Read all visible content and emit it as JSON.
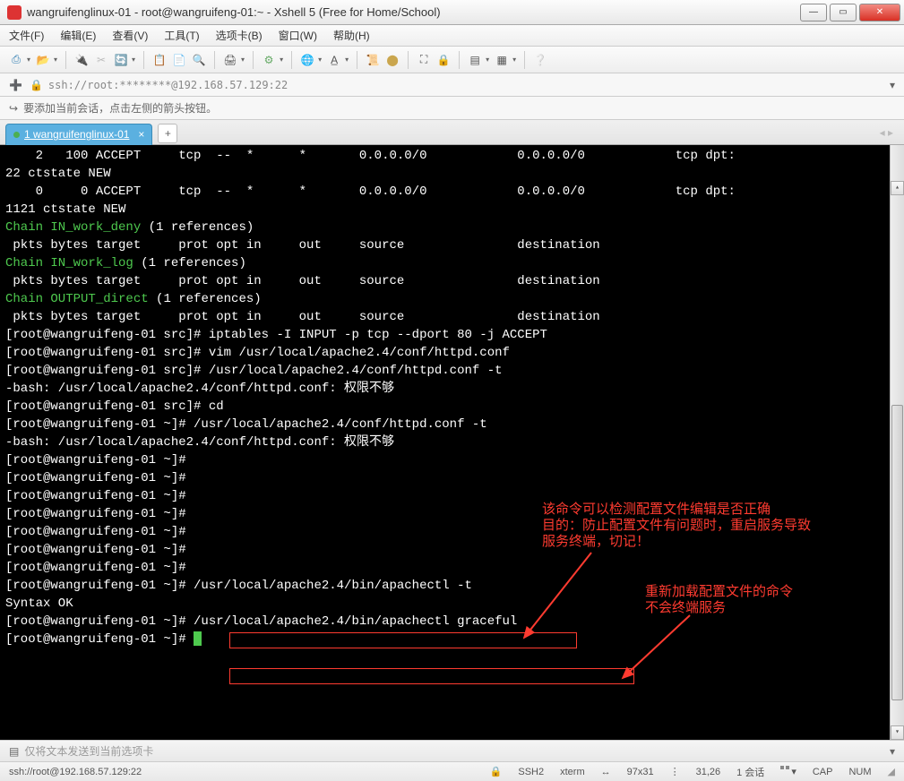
{
  "window": {
    "title": "wangruifenglinux-01 - root@wangruifeng-01:~ - Xshell 5 (Free for Home/School)"
  },
  "menu": {
    "file": "文件(F)",
    "edit": "编辑(E)",
    "view": "查看(V)",
    "tools": "工具(T)",
    "tabs": "选项卡(B)",
    "window": "窗口(W)",
    "help": "帮助(H)"
  },
  "address": "ssh://root:********@192.168.57.129:22",
  "infobar_text": "要添加当前会话，点击左侧的箭头按钮。",
  "tab": {
    "name": "1 wangruifenglinux-01"
  },
  "terminal_lines": [
    "    2   100 ACCEPT     tcp  --  *      *       0.0.0.0/0            0.0.0.0/0            tcp dpt:",
    "22 ctstate NEW",
    "    0     0 ACCEPT     tcp  --  *      *       0.0.0.0/0            0.0.0.0/0            tcp dpt:",
    "1121 ctstate NEW",
    "",
    "Chain IN_work_deny (1 references)",
    " pkts bytes target     prot opt in     out     source               destination",
    "",
    "Chain IN_work_log (1 references)",
    " pkts bytes target     prot opt in     out     source               destination",
    "",
    "Chain OUTPUT_direct (1 references)",
    " pkts bytes target     prot opt in     out     source               destination",
    "[root@wangruifeng-01 src]# iptables -I INPUT -p tcp --dport 80 -j ACCEPT",
    "[root@wangruifeng-01 src]# vim /usr/local/apache2.4/conf/httpd.conf",
    "[root@wangruifeng-01 src]# /usr/local/apache2.4/conf/httpd.conf -t",
    "-bash: /usr/local/apache2.4/conf/httpd.conf: 权限不够",
    "[root@wangruifeng-01 src]# cd",
    "[root@wangruifeng-01 ~]# /usr/local/apache2.4/conf/httpd.conf -t",
    "-bash: /usr/local/apache2.4/conf/httpd.conf: 权限不够",
    "[root@wangruifeng-01 ~]#",
    "[root@wangruifeng-01 ~]#",
    "[root@wangruifeng-01 ~]#",
    "[root@wangruifeng-01 ~]#",
    "[root@wangruifeng-01 ~]#",
    "[root@wangruifeng-01 ~]#",
    "[root@wangruifeng-01 ~]#",
    "[root@wangruifeng-01 ~]# /usr/local/apache2.4/bin/apachectl -t",
    "Syntax OK",
    "[root@wangruifeng-01 ~]# /usr/local/apache2.4/bin/apachectl graceful",
    "[root@wangruifeng-01 ~]# "
  ],
  "annotations": {
    "note1_l1": "该命令可以检测配置文件编辑是否正确",
    "note1_l2": "目的：防止配置文件有问题时，重启服务导致",
    "note1_l3": "服务终端，切记！",
    "note2_l1": "重新加载配置文件的命令",
    "note2_l2": "不会终端服务"
  },
  "boxed_commands": {
    "cmd1": "/usr/local/apache2.4/bin/apachectl -t",
    "cmd2": "/usr/local/apache2.4/bin/apachectl graceful"
  },
  "footer": {
    "send_text": "仅将文本发送到当前选项卡"
  },
  "status": {
    "conn": "ssh://root@192.168.57.129:22",
    "proto": "SSH2",
    "term": "xterm",
    "size": "97x31",
    "pos": "31,26",
    "session": "1 会话",
    "cap": "CAP",
    "num": "NUM"
  },
  "colors": {
    "annot": "#ff3b30",
    "prompt": "#4ec94e"
  }
}
